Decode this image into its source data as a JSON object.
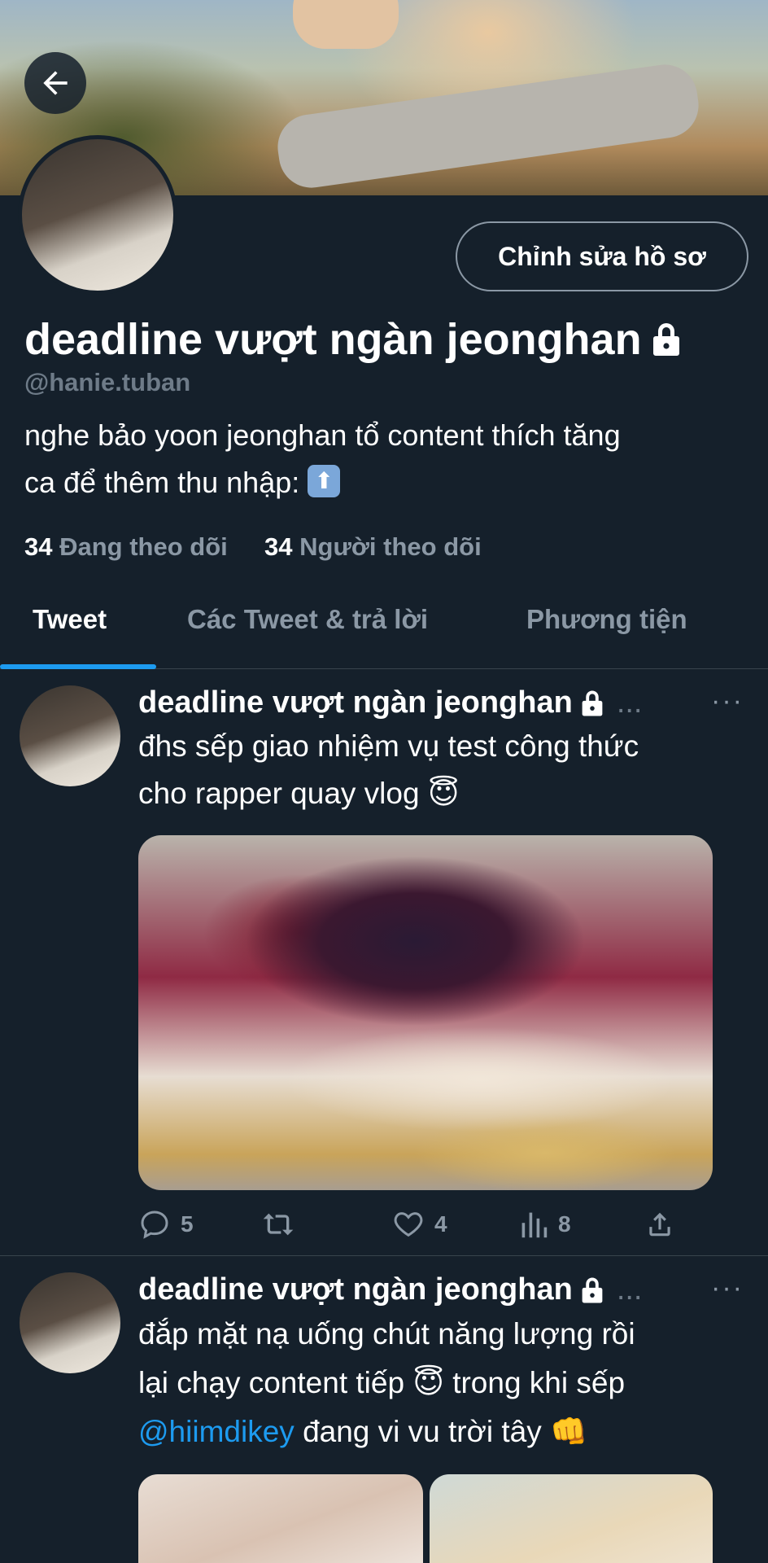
{
  "header": {
    "edit_profile_label": "Chỉnh sửa hồ sơ"
  },
  "profile": {
    "display_name": "deadline vượt ngàn jeonghan",
    "handle": "@hanie.tuban",
    "bio_line1": "nghe bảo yoon jeonghan tổ content thích tăng",
    "bio_line2": "ca để thêm thu nhập:",
    "bio_emoji": "⬆",
    "following_count": "34",
    "following_label": "Đang theo dõi",
    "followers_count": "34",
    "followers_label": "Người theo dõi"
  },
  "tabs": [
    {
      "label": "Tweet"
    },
    {
      "label": "Các Tweet & trả lời"
    },
    {
      "label": "Phương tiện"
    }
  ],
  "tweets": [
    {
      "author": "deadline vượt ngàn jeonghan",
      "ellipsis": "...",
      "more": "···",
      "line1": "đhs sếp giao nhiệm vụ test công thức",
      "line2": "cho rapper quay vlog",
      "emoji": "😇",
      "replies": "5",
      "likes": "4",
      "views": "8"
    },
    {
      "author": "deadline vượt ngàn jeonghan",
      "ellipsis": "...",
      "more": "···",
      "line1": "đắp mặt nạ uống chút năng lượng rồi",
      "line2a": "lại chạy content tiếp",
      "emoji": "😇",
      "line2b": " trong khi sếp",
      "mention": "@hiimdikey",
      "line3": " đang vi vu trời tây",
      "emoji2": "👊"
    }
  ],
  "colors": {
    "background": "#15202b",
    "accent": "#1d9bf0",
    "muted": "#8b98a5"
  }
}
